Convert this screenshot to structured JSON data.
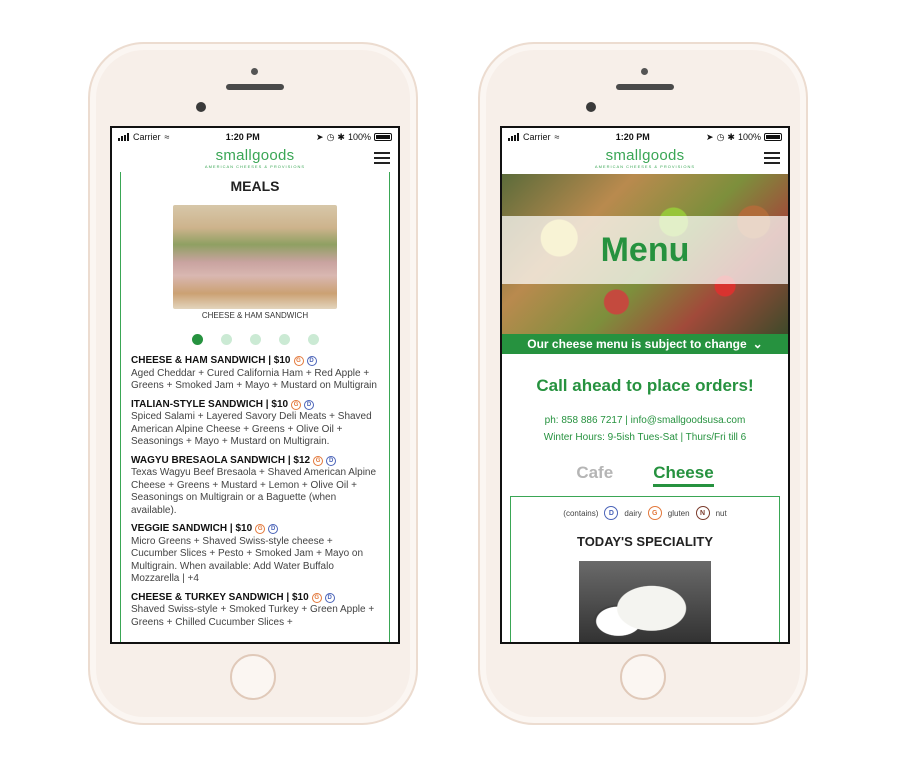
{
  "status": {
    "carrier": "Carrier",
    "time": "1:20 PM",
    "battery": "100%"
  },
  "brand": {
    "logo": "smallgoods",
    "tagline": "AMERICAN CHEESES & PROVISIONS",
    "green": "#26923f"
  },
  "left": {
    "title": "MEALS",
    "image_caption": "CHEESE & HAM SANDWICH",
    "carousel": {
      "count": 5,
      "active_index": 0
    },
    "items": [
      {
        "title": "CHEESE & HAM SANDWICH | $10",
        "desc": "Aged Cheddar + Cured California Ham + Red Apple + Greens + Smoked Jam + Mayo + Mustard on Multigrain",
        "icons": [
          "gluten",
          "dairy"
        ]
      },
      {
        "title": "ITALIAN-STYLE SANDWICH | $10",
        "desc": "Spiced Salami + Layered Savory Deli Meats + Shaved American Alpine Cheese + Greens + Olive Oil + Seasonings + Mayo + Mustard on Multigrain.",
        "icons": [
          "gluten",
          "dairy"
        ]
      },
      {
        "title": "WAGYU BRESAOLA SANDWICH | $12",
        "desc": "Texas Wagyu Beef Bresaola + Shaved American Alpine Cheese + Greens + Mustard + Lemon + Olive Oil + Seasonings on Multigrain or a Baguette (when available).",
        "icons": [
          "gluten",
          "dairy"
        ]
      },
      {
        "title": "VEGGIE SANDWICH | $10",
        "desc": "Micro Greens + Shaved Swiss-style cheese + Cucumber Slices + Pesto + Smoked Jam + Mayo on Multigrain. When available: Add Water Buffalo Mozzarella | +4",
        "icons": [
          "gluten",
          "dairy"
        ]
      },
      {
        "title": "CHEESE & TURKEY SANDWICH | $10",
        "desc": "Shaved Swiss-style + Smoked Turkey + Green Apple + Greens + Chilled Cucumber Slices +",
        "icons": [
          "gluten",
          "dairy"
        ]
      }
    ]
  },
  "right": {
    "hero_title": "Menu",
    "notice": "Our cheese menu is subject to change",
    "call": "Call ahead to place orders!",
    "phone_line": "ph: 858 886 7217 | info@smallgoodsusa.com",
    "hours_line": "Winter Hours: 9-5ish Tues-Sat | Thurs/Fri till 6",
    "tabs": [
      {
        "label": "Cafe",
        "active": false
      },
      {
        "label": "Cheese",
        "active": true
      }
    ],
    "legend": {
      "contains": "(contains)",
      "dairy": "dairy",
      "gluten": "gluten",
      "nut": "nut"
    },
    "speciality_title": "TODAY'S SPECIALITY"
  }
}
